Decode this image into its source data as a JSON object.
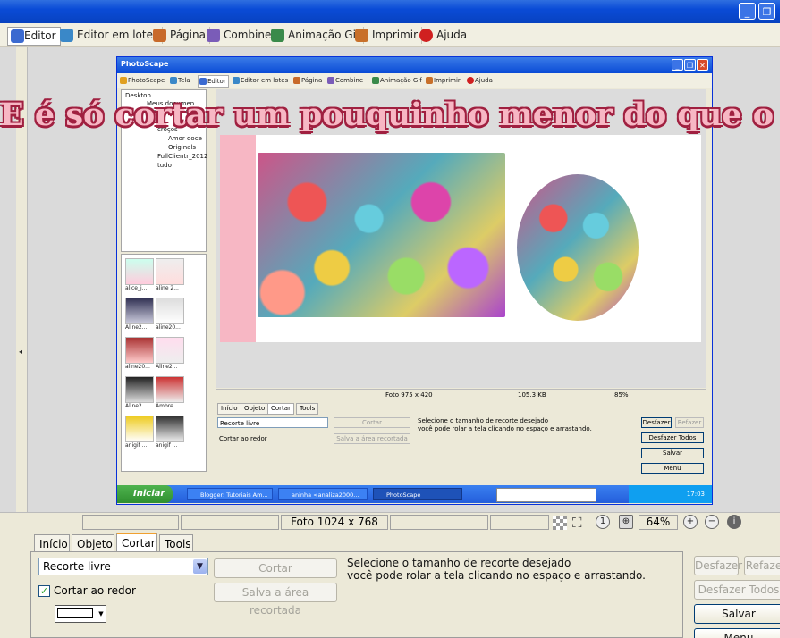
{
  "outer": {
    "menu": [
      {
        "label": "Editor",
        "icon": "editor-icon",
        "color": "#3b6ad0"
      },
      {
        "label": "Editor em lotes",
        "icon": "batch-editor-icon",
        "color": "#3a88c8"
      },
      {
        "label": "Página",
        "icon": "page-icon",
        "color": "#c86a2a"
      },
      {
        "label": "Combine",
        "icon": "combine-icon",
        "color": "#7a5cb8"
      },
      {
        "label": "Animação Gif",
        "icon": "gif-animation-icon",
        "color": "#3a8a4a"
      },
      {
        "label": "Imprimir",
        "icon": "print-icon",
        "color": "#c8702a"
      },
      {
        "label": "Ajuda",
        "icon": "help-icon",
        "color": "#d02020"
      }
    ]
  },
  "inner": {
    "title": "PhotoScape",
    "menu": [
      "PhotoScape",
      "Tela",
      "Editor",
      "Editor em lotes",
      "Página",
      "Combine",
      "Animação Gif",
      "Imprimir",
      "Ajuda"
    ],
    "tree": [
      "Desktop",
      "Meus documen",
      "Miscellaneous",
      "croços",
      "Amor doce",
      "Originals",
      "FullClientr_2012",
      "tudo"
    ],
    "thumbs": [
      "alice_j...",
      "aline 2...",
      "Aline2...",
      "aline20...",
      "aline20...",
      "Aline2...",
      "Aline2...",
      "Ambre ...",
      "anigif ...",
      "anigif ..."
    ],
    "status": {
      "photo": "Foto 975 x 420",
      "size": "105.3 KB",
      "zoom": "85%"
    },
    "tabs": [
      "Início",
      "Objeto",
      "Cortar",
      "Tools"
    ],
    "select": "Recorte livre",
    "cut_label": "Cortar",
    "save_area": "Salva a área recortada",
    "check_label": "Cortar ao redor",
    "hint1": "Selecione o tamanho de recorte desejado",
    "hint2": "você pode rolar a tela clicando no espaço e arrastando.",
    "buttons": [
      "Desfazer",
      "Refazer",
      "Desfazer Todos",
      "Salvar",
      "Menu"
    ],
    "taskbar": {
      "start": "Iniciar",
      "items": [
        "Blogger: Tutoriais Am...",
        "aninha <analiza2000...",
        "PhotoScape"
      ],
      "time": "17:03"
    }
  },
  "caption": "E é só cortar um pouquinho menor do que o círculo.",
  "status": {
    "photo": "Foto 1024 x 768",
    "zoom": "64%"
  },
  "panel": {
    "tabs": [
      "Início",
      "Objeto",
      "Cortar",
      "Tools"
    ],
    "active_tab": "Cortar",
    "select_value": "Recorte livre",
    "cut_button": "Cortar",
    "save_area_button": "Salva a área recortada",
    "checkbox_label": "Cortar ao redor",
    "hint_line1": "Selecione o tamanho de recorte desejado",
    "hint_line2": "você pode rolar a tela clicando no espaço e arrastando.",
    "undo": "Desfazer",
    "redo": "Refaze",
    "undo_all": "Desfazer Todos",
    "save": "Salvar",
    "menu": "Menu"
  }
}
